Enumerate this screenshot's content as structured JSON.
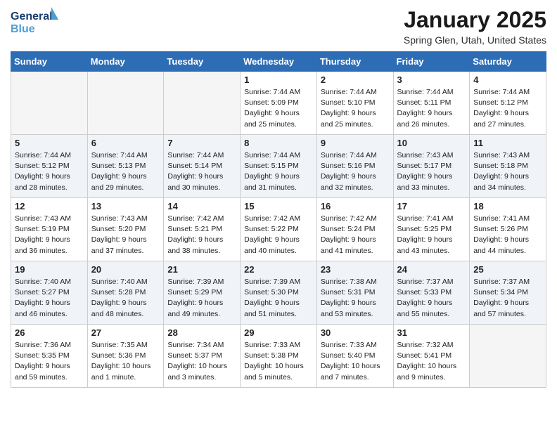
{
  "header": {
    "logo_line1": "General",
    "logo_line2": "Blue",
    "month": "January 2025",
    "location": "Spring Glen, Utah, United States"
  },
  "weekdays": [
    "Sunday",
    "Monday",
    "Tuesday",
    "Wednesday",
    "Thursday",
    "Friday",
    "Saturday"
  ],
  "weeks": [
    [
      {
        "day": "",
        "info": ""
      },
      {
        "day": "",
        "info": ""
      },
      {
        "day": "",
        "info": ""
      },
      {
        "day": "1",
        "info": "Sunrise: 7:44 AM\nSunset: 5:09 PM\nDaylight: 9 hours and 25 minutes."
      },
      {
        "day": "2",
        "info": "Sunrise: 7:44 AM\nSunset: 5:10 PM\nDaylight: 9 hours and 25 minutes."
      },
      {
        "day": "3",
        "info": "Sunrise: 7:44 AM\nSunset: 5:11 PM\nDaylight: 9 hours and 26 minutes."
      },
      {
        "day": "4",
        "info": "Sunrise: 7:44 AM\nSunset: 5:12 PM\nDaylight: 9 hours and 27 minutes."
      }
    ],
    [
      {
        "day": "5",
        "info": "Sunrise: 7:44 AM\nSunset: 5:12 PM\nDaylight: 9 hours and 28 minutes."
      },
      {
        "day": "6",
        "info": "Sunrise: 7:44 AM\nSunset: 5:13 PM\nDaylight: 9 hours and 29 minutes."
      },
      {
        "day": "7",
        "info": "Sunrise: 7:44 AM\nSunset: 5:14 PM\nDaylight: 9 hours and 30 minutes."
      },
      {
        "day": "8",
        "info": "Sunrise: 7:44 AM\nSunset: 5:15 PM\nDaylight: 9 hours and 31 minutes."
      },
      {
        "day": "9",
        "info": "Sunrise: 7:44 AM\nSunset: 5:16 PM\nDaylight: 9 hours and 32 minutes."
      },
      {
        "day": "10",
        "info": "Sunrise: 7:43 AM\nSunset: 5:17 PM\nDaylight: 9 hours and 33 minutes."
      },
      {
        "day": "11",
        "info": "Sunrise: 7:43 AM\nSunset: 5:18 PM\nDaylight: 9 hours and 34 minutes."
      }
    ],
    [
      {
        "day": "12",
        "info": "Sunrise: 7:43 AM\nSunset: 5:19 PM\nDaylight: 9 hours and 36 minutes."
      },
      {
        "day": "13",
        "info": "Sunrise: 7:43 AM\nSunset: 5:20 PM\nDaylight: 9 hours and 37 minutes."
      },
      {
        "day": "14",
        "info": "Sunrise: 7:42 AM\nSunset: 5:21 PM\nDaylight: 9 hours and 38 minutes."
      },
      {
        "day": "15",
        "info": "Sunrise: 7:42 AM\nSunset: 5:22 PM\nDaylight: 9 hours and 40 minutes."
      },
      {
        "day": "16",
        "info": "Sunrise: 7:42 AM\nSunset: 5:24 PM\nDaylight: 9 hours and 41 minutes."
      },
      {
        "day": "17",
        "info": "Sunrise: 7:41 AM\nSunset: 5:25 PM\nDaylight: 9 hours and 43 minutes."
      },
      {
        "day": "18",
        "info": "Sunrise: 7:41 AM\nSunset: 5:26 PM\nDaylight: 9 hours and 44 minutes."
      }
    ],
    [
      {
        "day": "19",
        "info": "Sunrise: 7:40 AM\nSunset: 5:27 PM\nDaylight: 9 hours and 46 minutes."
      },
      {
        "day": "20",
        "info": "Sunrise: 7:40 AM\nSunset: 5:28 PM\nDaylight: 9 hours and 48 minutes."
      },
      {
        "day": "21",
        "info": "Sunrise: 7:39 AM\nSunset: 5:29 PM\nDaylight: 9 hours and 49 minutes."
      },
      {
        "day": "22",
        "info": "Sunrise: 7:39 AM\nSunset: 5:30 PM\nDaylight: 9 hours and 51 minutes."
      },
      {
        "day": "23",
        "info": "Sunrise: 7:38 AM\nSunset: 5:31 PM\nDaylight: 9 hours and 53 minutes."
      },
      {
        "day": "24",
        "info": "Sunrise: 7:37 AM\nSunset: 5:33 PM\nDaylight: 9 hours and 55 minutes."
      },
      {
        "day": "25",
        "info": "Sunrise: 7:37 AM\nSunset: 5:34 PM\nDaylight: 9 hours and 57 minutes."
      }
    ],
    [
      {
        "day": "26",
        "info": "Sunrise: 7:36 AM\nSunset: 5:35 PM\nDaylight: 9 hours and 59 minutes."
      },
      {
        "day": "27",
        "info": "Sunrise: 7:35 AM\nSunset: 5:36 PM\nDaylight: 10 hours and 1 minute."
      },
      {
        "day": "28",
        "info": "Sunrise: 7:34 AM\nSunset: 5:37 PM\nDaylight: 10 hours and 3 minutes."
      },
      {
        "day": "29",
        "info": "Sunrise: 7:33 AM\nSunset: 5:38 PM\nDaylight: 10 hours and 5 minutes."
      },
      {
        "day": "30",
        "info": "Sunrise: 7:33 AM\nSunset: 5:40 PM\nDaylight: 10 hours and 7 minutes."
      },
      {
        "day": "31",
        "info": "Sunrise: 7:32 AM\nSunset: 5:41 PM\nDaylight: 10 hours and 9 minutes."
      },
      {
        "day": "",
        "info": ""
      }
    ]
  ]
}
